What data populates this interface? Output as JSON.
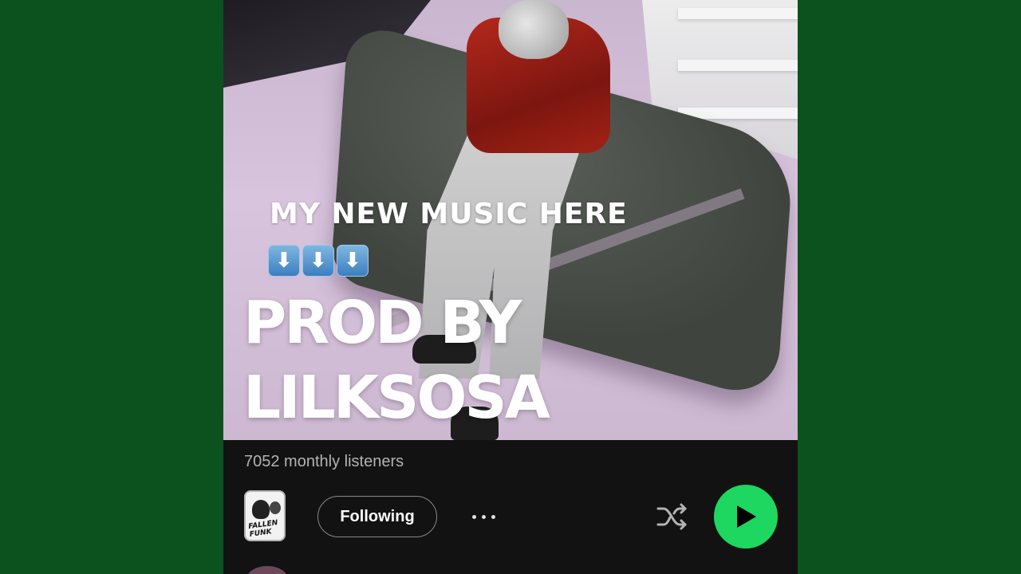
{
  "artist": {
    "banner_line": "MY NEW MUSIC HERE",
    "arrow_emoji": [
      "⬇",
      "⬇",
      "⬇"
    ],
    "name": "PROD BY LILKSOSA",
    "monthly_listeners": "7052 monthly listeners"
  },
  "avatar": {
    "logo_text": "FALLEN FUNK"
  },
  "controls": {
    "follow_label": "Following",
    "more_icon": "more-dots-icon",
    "shuffle_icon": "shuffle-icon",
    "play_icon": "play-icon"
  },
  "colors": {
    "background": "#0b521f",
    "panel": "#121212",
    "accent": "#1ed760",
    "muted_text": "#b3b3b3"
  }
}
